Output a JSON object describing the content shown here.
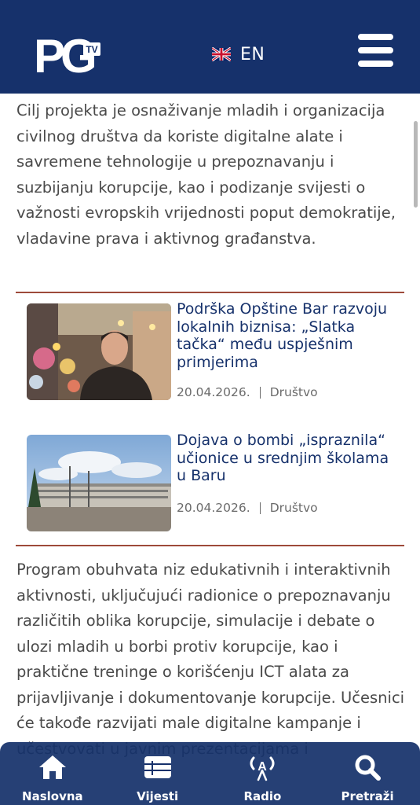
{
  "header": {
    "logo_text": "PG",
    "logo_tv": "TV",
    "language": {
      "label": "EN",
      "flag": "uk-flag-icon"
    },
    "menu_icon": "hamburger-menu-icon"
  },
  "content": {
    "intro_paragraph": "Cilj projekta je osnaživanje mladih i organizacija civilnog društva da koriste digitalne alate i savremene tehnologije u prepoznavanju i suzbijanju korupcije, kao i podizanje svijesti o važnosti evropskih vrijednosti poput demokratije, vladavine prava i aktivnog građanstva.",
    "related_articles": [
      {
        "title": "Podrška Opštine Bar razvoju lokalnih biznisa: „Slatka tačka“ među uspješnim primjerima",
        "date": "20.04.2026.",
        "category": "Društvo"
      },
      {
        "title": "Dojava o bombi „ispraznila“ učionice u srednjim školama u Baru",
        "date": "20.04.2026.",
        "category": "Društvo"
      }
    ],
    "second_paragraph": "Program obuhvata niz edukativnih i interaktivnih aktivnosti, uključujući radionice o prepoznavanju različitih oblika korupcije, simulacije i debate o ulozi mladih u borbi protiv korupcije, kao i praktične treninge o korišćenju ICT alata za prijavljivanje i dokumentovanje korupcije. Učesnici će takođe razvijati male digitalne kampanje i učestvovati u javnim prezentacijama i"
  },
  "bottom_nav": [
    {
      "label": "Naslovna",
      "icon": "home-icon"
    },
    {
      "label": "Vijesti",
      "icon": "news-list-icon"
    },
    {
      "label": "Radio",
      "icon": "radio-icon"
    },
    {
      "label": "Pretraži",
      "icon": "search-icon"
    }
  ],
  "colors": {
    "brand_navy": "#16316b",
    "divider": "#9e4a3a",
    "body_text": "#4a4a4a",
    "meta_text": "#6b6b6b"
  }
}
